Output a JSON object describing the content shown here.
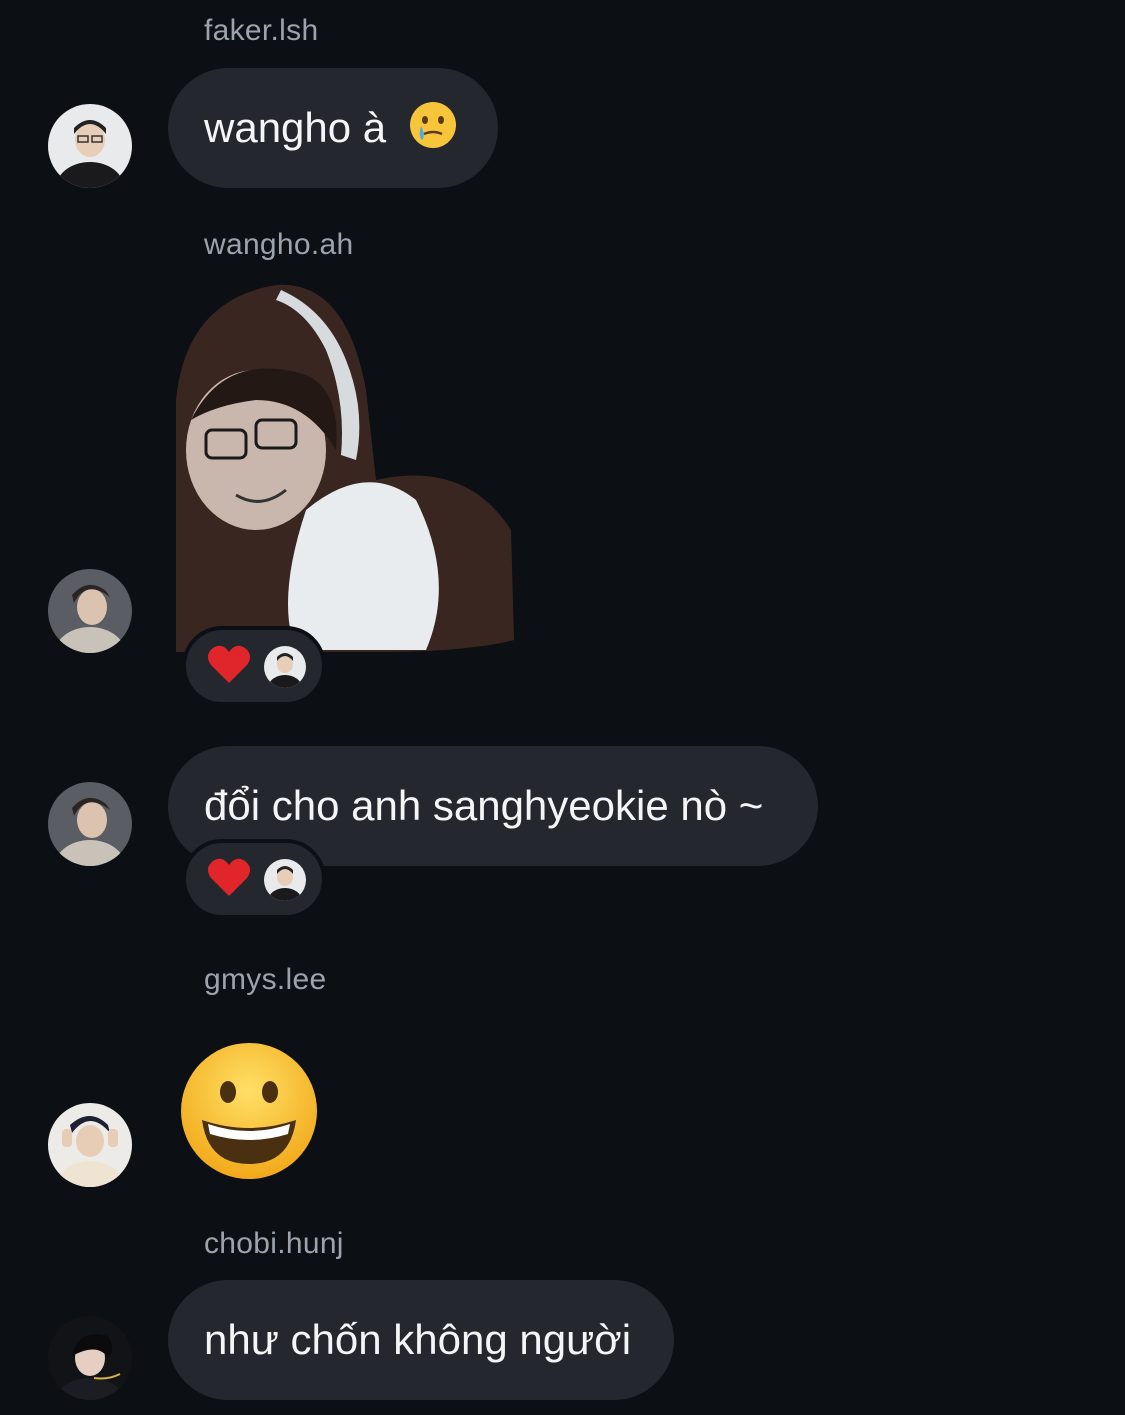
{
  "messages": [
    {
      "username": "faker.lsh",
      "text": "wangho à",
      "emoji": "crying-smile-emoji"
    },
    {
      "username": "wangho.ah",
      "sticker": "sticker-image",
      "reaction": "red-heart-emoji"
    },
    {
      "text": "đổi cho anh sanghyeokie nò ~",
      "reaction": "red-heart-emoji"
    },
    {
      "username": "gmys.lee",
      "emoji": "grinning-face-emoji"
    },
    {
      "username": "chobi.hunj",
      "text": "như chốn không người"
    }
  ],
  "colors": {
    "background": "#0c0f14",
    "bubble": "#24272d",
    "username": "#9da3ad",
    "text": "#f4f5f7"
  }
}
